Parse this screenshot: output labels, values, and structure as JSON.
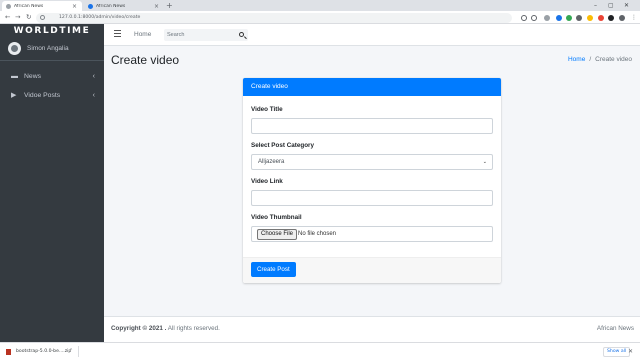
{
  "browser": {
    "tabs": [
      {
        "title": "African News",
        "active": true
      },
      {
        "title": "African News",
        "active": false
      }
    ],
    "new_tab_glyph": "+",
    "tab_close_glyph": "×",
    "window_controls": {
      "minimize": "–",
      "maximize": "▢",
      "close": "✕"
    },
    "nav": {
      "back": "←",
      "forward": "→",
      "reload": "↻"
    },
    "address": "127.0.0.1:8000/admin/video/create",
    "extension_icons": [
      "extension-icon",
      "extension-icon",
      "extension-icon",
      "extension-icon",
      "extension-icon",
      "extension-icon",
      "extension-icon",
      "extension-icon",
      "extension-icon",
      "extension-icon"
    ],
    "menu_glyph": "⋮",
    "profile_glyph": "●"
  },
  "sidebar": {
    "brand": "WORLDTIME",
    "user_name": "Simon Angalia",
    "items": [
      {
        "label": "News",
        "icon": "newspaper-icon",
        "glyph": "▬",
        "chevron": "‹"
      },
      {
        "label": "Vidoe Posts",
        "icon": "play-icon",
        "glyph": "▶",
        "chevron": "‹"
      }
    ]
  },
  "topnav": {
    "home": "Home",
    "search_placeholder": "Search"
  },
  "page": {
    "title": "Create video",
    "breadcrumb": {
      "home": "Home",
      "separator": "/",
      "current": "Create video"
    }
  },
  "form": {
    "header": "Create video",
    "video_title_label": "Video Title",
    "video_title_value": "",
    "category_label": "Select Post Category",
    "category_value": "Alljazeera",
    "category_chevron": "⌄",
    "video_link_label": "Video Link",
    "video_link_value": "",
    "thumbnail_label": "Video Thumbnail",
    "choose_file": "Choose File",
    "no_file": "No file chosen",
    "submit": "Create Post"
  },
  "footer": {
    "copyright_prefix": "Copyright © 2021 .",
    "copyright_suffix": " All rights reserved.",
    "app_name": "African News"
  },
  "downloads": {
    "file": "bootstrap-5.0.0-be....zip",
    "chevron": "⌃",
    "show_all": "Show all",
    "close": "✕"
  },
  "colors": {
    "primary": "#007bff",
    "sidebar": "#343a40",
    "content_bg": "#f4f6f9"
  }
}
